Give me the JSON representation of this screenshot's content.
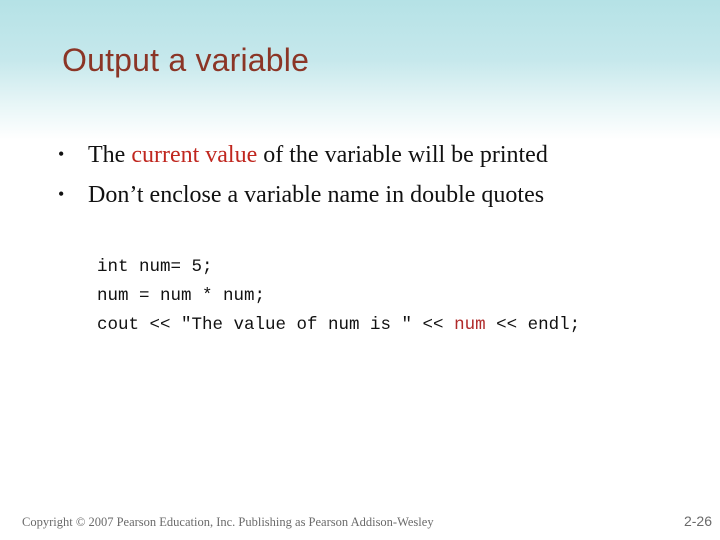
{
  "slide": {
    "title": "Output a variable",
    "bullets": [
      {
        "before": "The ",
        "highlight": "current value",
        "after": " of the variable will be printed"
      },
      {
        "before": "Don’t enclose a variable name in double quotes",
        "highlight": "",
        "after": ""
      }
    ],
    "bullet_glyph": "•",
    "code": [
      {
        "text": "int num= 5;",
        "highlight": "",
        "after": ""
      },
      {
        "text": "num = num * num;",
        "highlight": "",
        "after": ""
      },
      {
        "text": "cout << \"The value of num is \" << ",
        "highlight": "num",
        "after": " << endl;"
      }
    ],
    "colors": {
      "title": "#8b3526",
      "highlight": "#c0271f",
      "code_highlight": "#b02a2a"
    }
  },
  "footer": {
    "copyright": "Copyright © 2007 Pearson Education, Inc. Publishing as Pearson Addison-Wesley",
    "page_number": "2-26"
  }
}
